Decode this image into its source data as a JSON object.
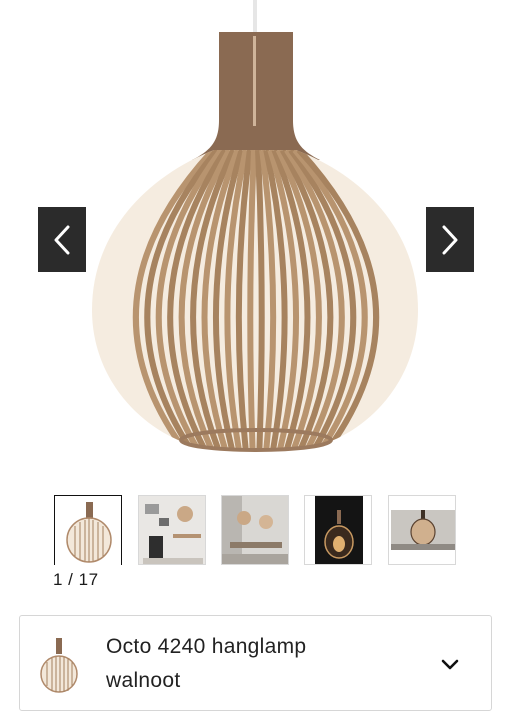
{
  "gallery": {
    "main_image_alt": "Octo 4240 hanglamp walnoot",
    "prev_icon": "chevron-left-icon",
    "next_icon": "chevron-right-icon",
    "counter": "1 / 17",
    "thumbnail_count": 5,
    "active_thumbnail": 1
  },
  "product": {
    "title_line1": "Octo 4240 hanglamp",
    "title_line2": "walnoot",
    "expand_icon": "chevron-down-icon"
  },
  "colors": {
    "wood": "#b08a6b",
    "wood_dark": "#7a5a44",
    "nav_bg": "#2b2b2b",
    "card_border": "#d6d6d6"
  }
}
